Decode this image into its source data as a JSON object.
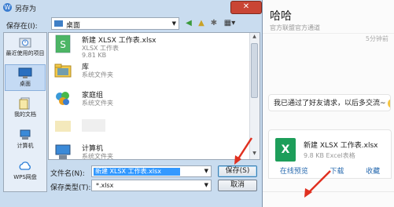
{
  "dialog": {
    "title": "另存为",
    "close_label": "✕",
    "save_in_label": "保存在(I):",
    "save_in_value": "桌面",
    "toolbar": {
      "back": "◀",
      "up": "▲",
      "new_folder": "✱",
      "view": "▦▾"
    }
  },
  "places": [
    {
      "label": "最近使用的项目"
    },
    {
      "label": "桌面"
    },
    {
      "label": "我的文档"
    },
    {
      "label": "计算机"
    },
    {
      "label": "WPS网盘"
    }
  ],
  "files": [
    {
      "name": "新建 XLSX 工作表.xlsx",
      "desc": "XLSX 工作表",
      "size": "9.81 KB"
    },
    {
      "name": "库",
      "desc": "系统文件夹",
      "size": ""
    },
    {
      "name": "家庭组",
      "desc": "系统文件夹",
      "size": ""
    },
    {
      "name": "",
      "desc": "",
      "size": ""
    },
    {
      "name": "计算机",
      "desc": "系统文件夹",
      "size": ""
    }
  ],
  "filename_label": "文件名(N):",
  "filename_value": "新建 XLSX 工作表.xlsx",
  "filetype_label": "保存类型(T):",
  "filetype_value": "*.xlsx",
  "save_button": "保存(S)",
  "cancel_button": "取消",
  "chat": {
    "title": "哈哈",
    "subtitle": "官方联盟官方通道",
    "time": "5分钟前",
    "message": "我已通过了好友请求，以后多交流~",
    "file_name": "新建 XLSX 工作表.xlsx",
    "file_meta": "9.8 KB     Excel表格",
    "file_icon": "X",
    "actions": [
      "在线预览",
      "下载",
      "收藏"
    ]
  },
  "colors": {
    "accent": "#3399ff",
    "excel": "#1d9e5a",
    "close": "#c94535",
    "arrow": "#e03020"
  }
}
